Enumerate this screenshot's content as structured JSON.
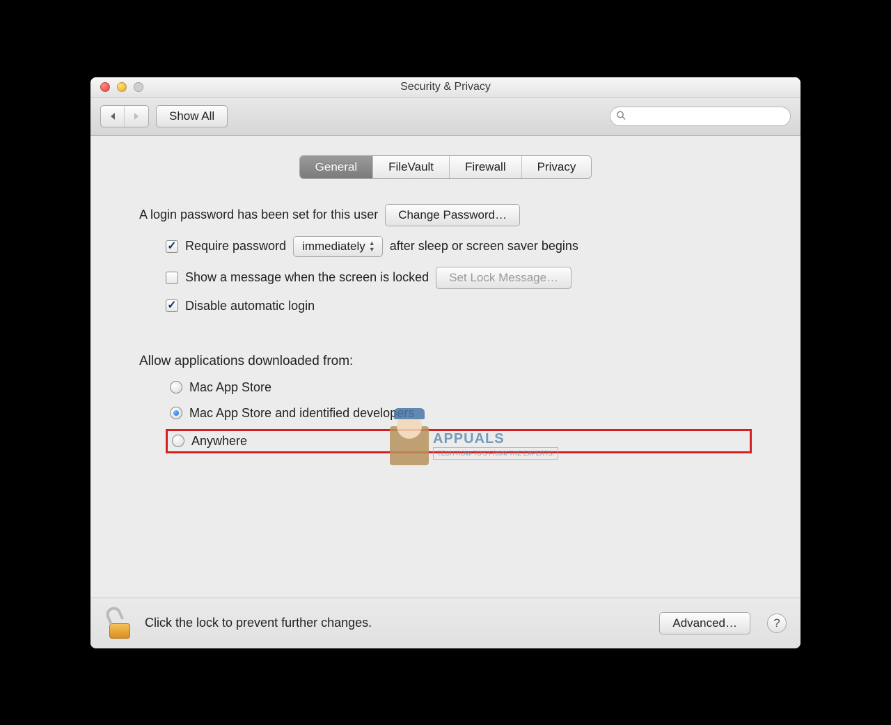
{
  "window": {
    "title": "Security & Privacy"
  },
  "toolbar": {
    "show_all": "Show All",
    "search_placeholder": ""
  },
  "tabs": [
    "General",
    "FileVault",
    "Firewall",
    "Privacy"
  ],
  "selected_tab": "General",
  "general": {
    "login_password_text": "A login password has been set for this user",
    "change_password": "Change Password…",
    "require_password_label": "Require password",
    "require_password_value": "immediately",
    "require_password_suffix": "after sleep or screen saver begins",
    "show_message_label": "Show a message when the screen is locked",
    "set_lock_message": "Set Lock Message…",
    "disable_auto_login": "Disable automatic login",
    "allow_apps_label": "Allow applications downloaded from:",
    "options": {
      "mas": "Mac App Store",
      "mas_dev": "Mac App Store and identified developers",
      "anywhere": "Anywhere"
    },
    "selected_option": "mas_dev",
    "require_password_checked": true,
    "show_message_checked": false,
    "disable_auto_login_checked": true
  },
  "footer": {
    "lock_text": "Click the lock to prevent further changes.",
    "advanced": "Advanced…",
    "help": "?"
  },
  "watermark": {
    "brand": "APPUALS",
    "tagline": "TECH HOW-TO'S FROM THE EXPERTS!"
  }
}
